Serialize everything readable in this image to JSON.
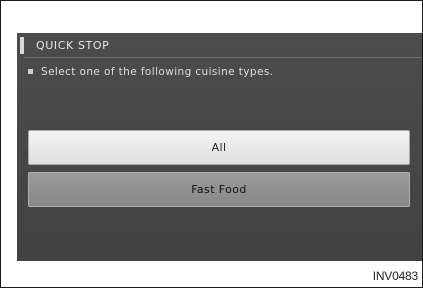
{
  "screen": {
    "title": "QUICK STOP",
    "instruction": "Select one of the following cuisine types.",
    "options": [
      {
        "label": "All",
        "highlighted": true
      },
      {
        "label": "Fast Food",
        "highlighted": false
      }
    ]
  },
  "figure_id": "INV0483",
  "colors": {
    "screen_background": "#474747",
    "highlight_button": "#e9e9e9",
    "normal_button": "#8f8f8f",
    "text_light": "#e6e6e6"
  }
}
